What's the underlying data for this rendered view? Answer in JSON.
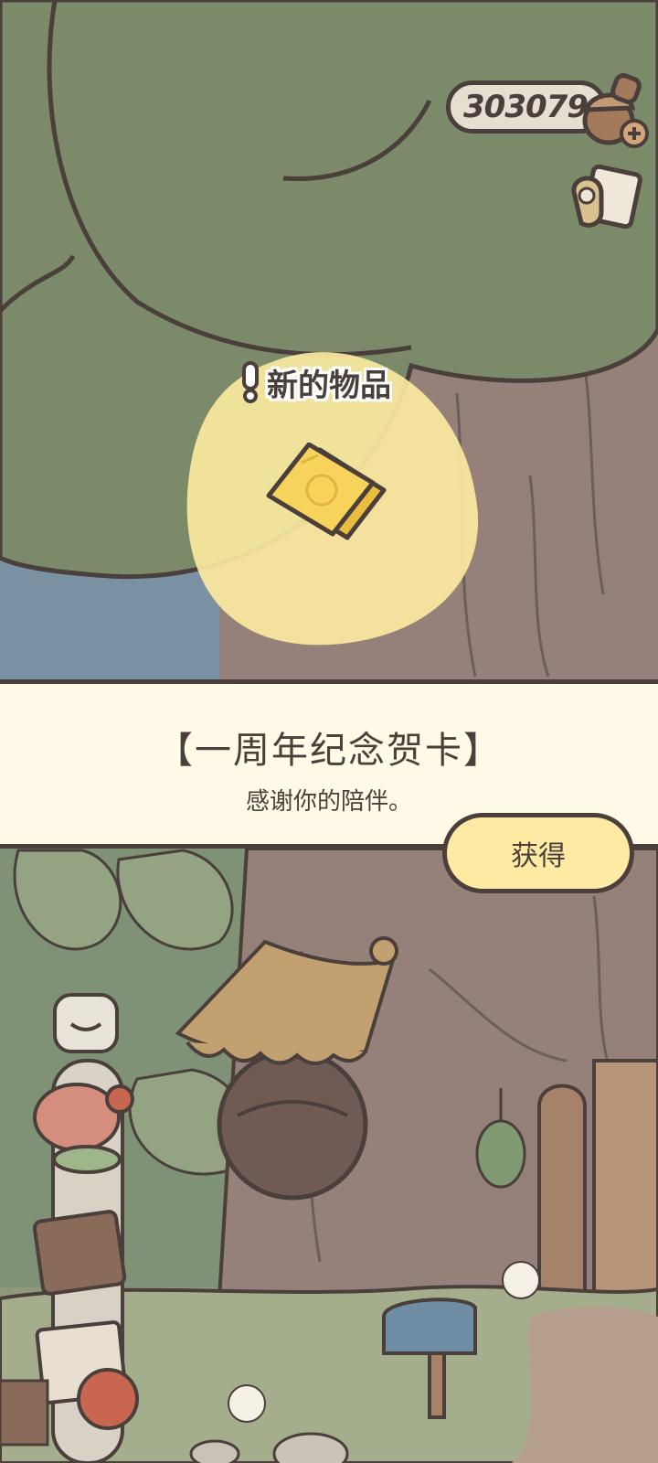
{
  "currency": {
    "amount": "303079",
    "icon": "acorn-clover-icon",
    "add_icon": "plus-icon"
  },
  "tickets": {
    "icon": "tickets-icon"
  },
  "new_item": {
    "label": "新的物品",
    "alert_icon": "exclamation-icon",
    "item_icon": "greeting-card-icon"
  },
  "dialog": {
    "title": "【一周年纪念贺卡】",
    "description": "感谢你的陪伴。",
    "obtain_button": "获得"
  },
  "colors": {
    "outline": "#4a3f3b",
    "banner_bg": "#fffbe7",
    "button_bg": "#ffeaa4",
    "highlight": "#fbe9a0",
    "tree_leaves": "#7b8a69",
    "trunk": "#95807a"
  }
}
